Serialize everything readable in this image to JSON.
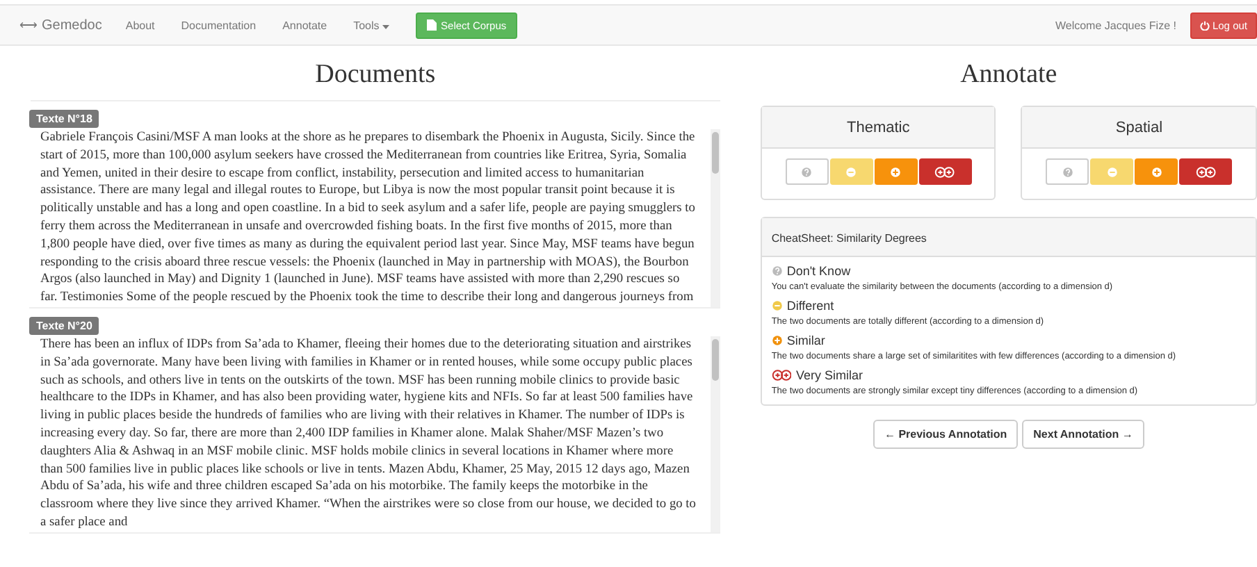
{
  "navbar": {
    "brand_icon": "⟷",
    "brand": "Gemedoc",
    "links": [
      "About",
      "Documentation",
      "Annotate"
    ],
    "tools_menu": "Tools",
    "select_button": "Select Corpus",
    "welcome": "Welcome Jacques Fize !",
    "logout_button": "Log out"
  },
  "documents": {
    "title": "Documents",
    "items": [
      {
        "label": "Texte N°18",
        "text": "Gabriele François Casini/MSF A man looks at the shore as he prepares to disembark the Phoenix in Augusta, Sicily. Since the start of 2015, more than 100,000 asylum seekers have crossed the Mediterranean from countries like Eritrea, Syria, Somalia and Yemen, united in their desire to escape from conflict, instability, persecution and limited access to humanitarian assistance. There are many legal and illegal routes to Europe, but Libya is now the most popular transit point because it is politically unstable and has a long and open coastline. In a bid to seek asylum and a safer life, people are paying smugglers to ferry them across the Mediterranean in unsafe and overcrowded fishing boats. In the first five months of 2015, more than 1,800 people have died, over five times as many as during the equivalent period last year. Since May, MSF teams have begun responding to the crisis aboard three rescue vessels: the Phoenix (launched in May in partnership with MOAS), the Bourbon Argos (also launched in May) and Dignity 1 (launched in June). MSF teams have assisted with more than 2,290 rescues so far. Testimonies Some of the people rescued by the Phoenix took the time to describe their long and dangerous journeys from"
      },
      {
        "label": "Texte N°20",
        "text": "There has been an influx of IDPs from Sa’ada to Khamer, fleeing their homes due to the deteriorating situation and airstrikes in Sa’ada governorate. Many have been living with families in Khamer or in rented houses, while some occupy public places such as schools, and others live in tents on the outskirts of the town. MSF has been running mobile clinics to provide basic healthcare to the IDPs in Khamer, and has also been providing water, hygiene kits and NFIs. So far at least 500 families have living in public places beside the hundreds of families who are living with their relatives in Khamer. The number of IDPs is increasing every day. So far, there are more than 2,400 IDP families in Khamer alone. Malak Shaher/MSF Mazen’s two daughters Alia & Ashwaq in an MSF mobile clinic. MSF holds mobile clinics in several locations in Khamer where more than 500 families live in public places like schools or live in tents. Mazen Abdu, Khamer, 25 May, 2015 12 days ago, Mazen Abdu of Sa’ada, his wife and three children escaped Sa’ada on his motorbike. The family keeps the motorbike in the classroom where they live since they arrived Khamer. “When the airstrikes were so close from our house, we decided to go to a safer place and"
      }
    ]
  },
  "annotate": {
    "title": "Annotate",
    "panels": [
      {
        "title": "Thematic",
        "options": [
          {
            "kind": "unknown",
            "color": "#ffffff",
            "selected": false
          },
          {
            "kind": "different",
            "color": "#f7d86f",
            "selected": false
          },
          {
            "kind": "similar",
            "color": "#f7920c",
            "selected": false
          },
          {
            "kind": "very_similar",
            "color": "#c9302c",
            "selected": false
          }
        ]
      },
      {
        "title": "Spatial",
        "options": [
          {
            "kind": "unknown",
            "color": "#ffffff",
            "selected": false
          },
          {
            "kind": "different",
            "color": "#f7d86f",
            "selected": false
          },
          {
            "kind": "similar",
            "color": "#f7920c",
            "selected": false
          },
          {
            "kind": "very_similar",
            "color": "#c9302c",
            "selected": false
          }
        ]
      }
    ],
    "cheatsheet": {
      "title": "CheatSheet: Similarity Degrees",
      "items": [
        {
          "kind": "unknown",
          "title": "Don't Know",
          "description": "You can't evaluate the similarity between the documents (according to a dimension d)"
        },
        {
          "kind": "different",
          "title": "Different",
          "description": "The two documents are totally different (according to a dimension d)"
        },
        {
          "kind": "similar",
          "title": "Similar",
          "description": "The two documents share a large set of similaritites with few differences (according to a dimension d)"
        },
        {
          "kind": "very_similar",
          "title": "Very Similar",
          "description": "The two documents are strongly similar except tiny differences (according to a dimension d)"
        }
      ]
    },
    "previous_button": "← Previous Annotation",
    "next_button": "Next Annotation →"
  }
}
